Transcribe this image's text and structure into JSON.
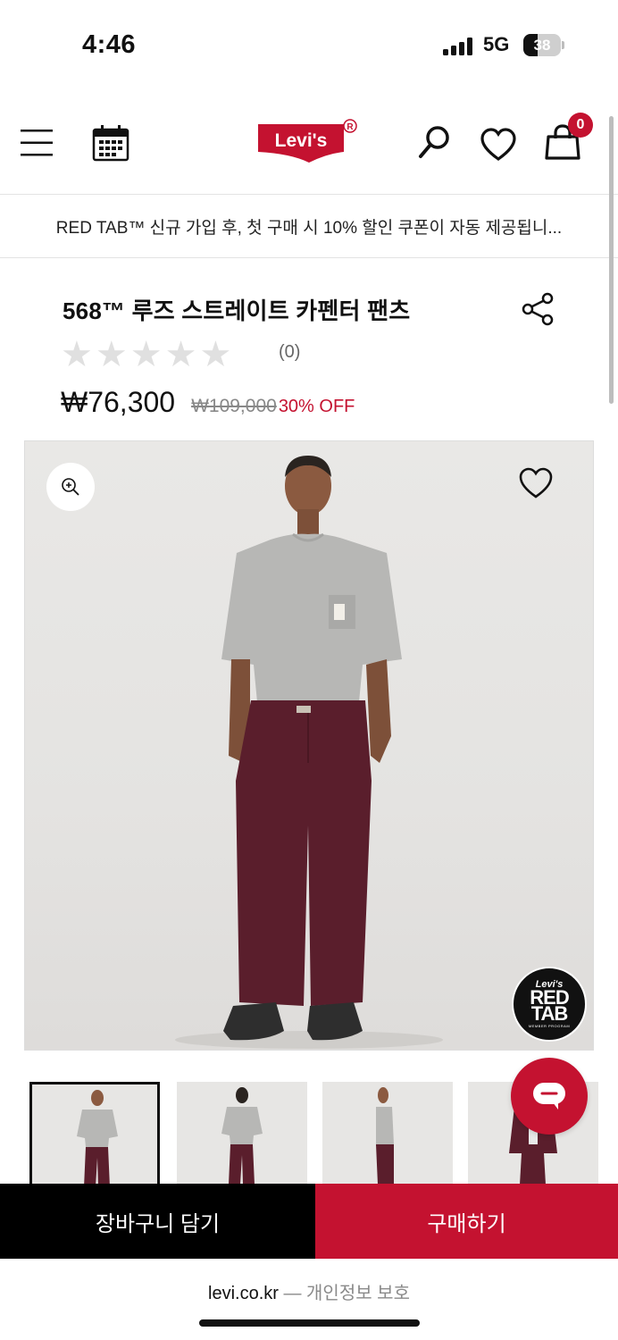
{
  "status_bar": {
    "time": "4:46",
    "network": "5G",
    "battery": "38",
    "battery_level": 0.38
  },
  "header": {
    "brand_logo_text": "Levi's",
    "registered_mark": "®",
    "cart_count": "0"
  },
  "promo_text": "RED TAB™ 신규 가입 후, 첫 구매 시 10% 할인 쿠폰이 자동 제공됩니...",
  "product": {
    "title": "568™ 루즈 스트레이트 카펜터 팬츠",
    "rating_stars": 0,
    "rating_max": 5,
    "review_count": "(0)",
    "price": "₩76,300",
    "original_price": "₩109,000",
    "discount": "30% OFF"
  },
  "hero": {
    "badge_line1": "Levi's",
    "badge_line2": "RED",
    "badge_line3": "TAB",
    "badge_line4": "MEMBER PROGRAM",
    "colors": {
      "shirt": "#b7b7b5",
      "pants": "#5a1e2c",
      "skin": "#8b5a40"
    }
  },
  "thumbnails": [
    {
      "view": "front"
    },
    {
      "view": "back"
    },
    {
      "view": "side"
    },
    {
      "view": "jacket"
    }
  ],
  "actions": {
    "add_to_cart": "장바구니 담기",
    "buy_now": "구매하기"
  },
  "browser": {
    "domain": "levi.co.kr",
    "suffix": " — 개인정보 보호"
  },
  "colors": {
    "accent_red": "#c41230",
    "black": "#000000"
  }
}
